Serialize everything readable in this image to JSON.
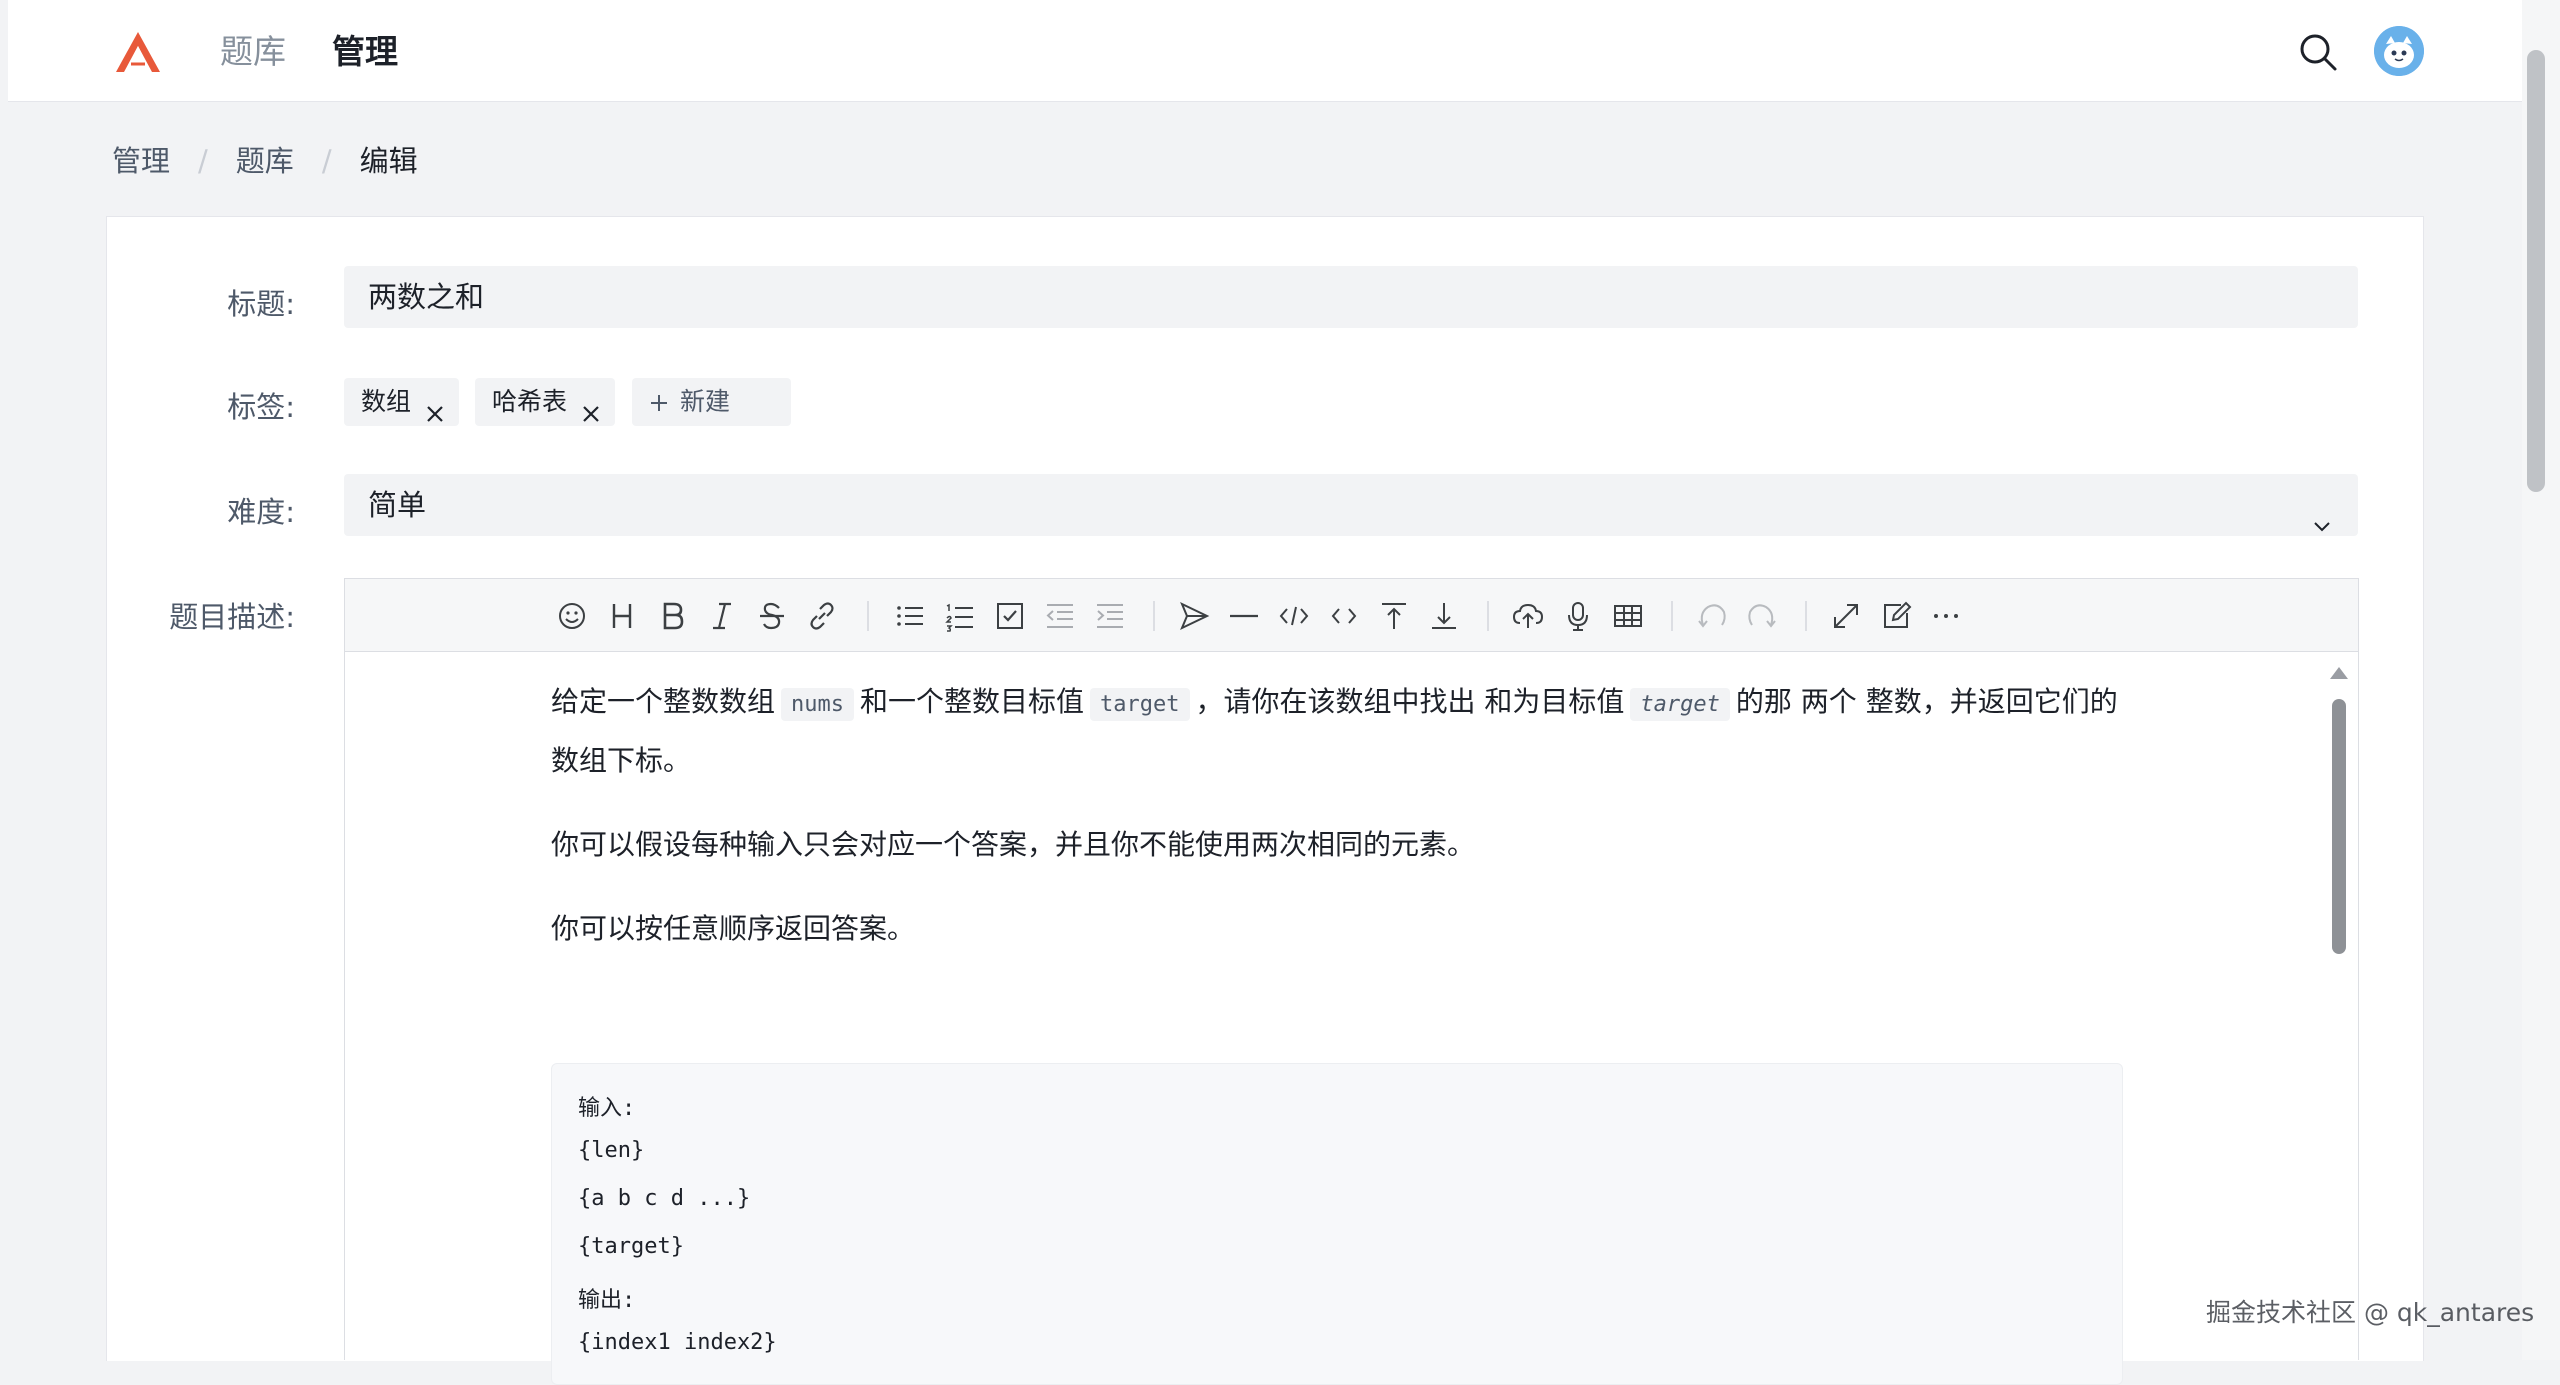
{
  "nav": {
    "logo": "logo-icon",
    "items": [
      "题库",
      "管理"
    ],
    "active": "管理"
  },
  "breadcrumb": {
    "items": [
      "管理",
      "题库",
      "编辑"
    ],
    "separator": "/"
  },
  "form": {
    "title_label": "标题:",
    "title_value": "两数之和",
    "tags_label": "标签:",
    "tags": [
      "数组",
      "哈希表"
    ],
    "new_tag_label": "新建",
    "difficulty_label": "难度:",
    "difficulty_value": "简单",
    "description_label": "题目描述:"
  },
  "editor": {
    "toolbar_icons": [
      "emoji-icon",
      "heading-icon",
      "bold-icon",
      "italic-icon",
      "strike-icon",
      "link-icon",
      "unordered-list-icon",
      "ordered-list-icon",
      "checklist-icon",
      "outdent-icon",
      "indent-icon",
      "quote-icon",
      "line-icon",
      "code-icon",
      "inline-code-icon",
      "insert-before-icon",
      "insert-after-icon",
      "upload-icon",
      "record-icon",
      "table-icon",
      "undo-icon",
      "redo-icon",
      "fullscreen-icon",
      "edit-mode-icon",
      "more-icon"
    ],
    "paragraph1": {
      "t1": "给定一个整数数组",
      "c1": "nums",
      "t2": "和一个整数目标值",
      "c2": "target",
      "t3": "，请你在该数组中找出 和为目标值",
      "c3": "target",
      "t4": "的那 两个 整数，并返回它们的数组下标。"
    },
    "paragraph2": "你可以假设每种输入只会对应一个答案，并且你不能使用两次相同的元素。",
    "paragraph3": "你可以按任意顺序返回答案。",
    "code_lines": [
      "输入:",
      "{len}",
      "{a b c d ...}",
      "{target}",
      "输出:",
      "{index1 index2}"
    ]
  },
  "watermark": "掘金技术社区 @ qk_antares",
  "colors": {
    "logo": "#e8593a",
    "avatar": "#69b1ea",
    "background": "#f2f3f5"
  }
}
